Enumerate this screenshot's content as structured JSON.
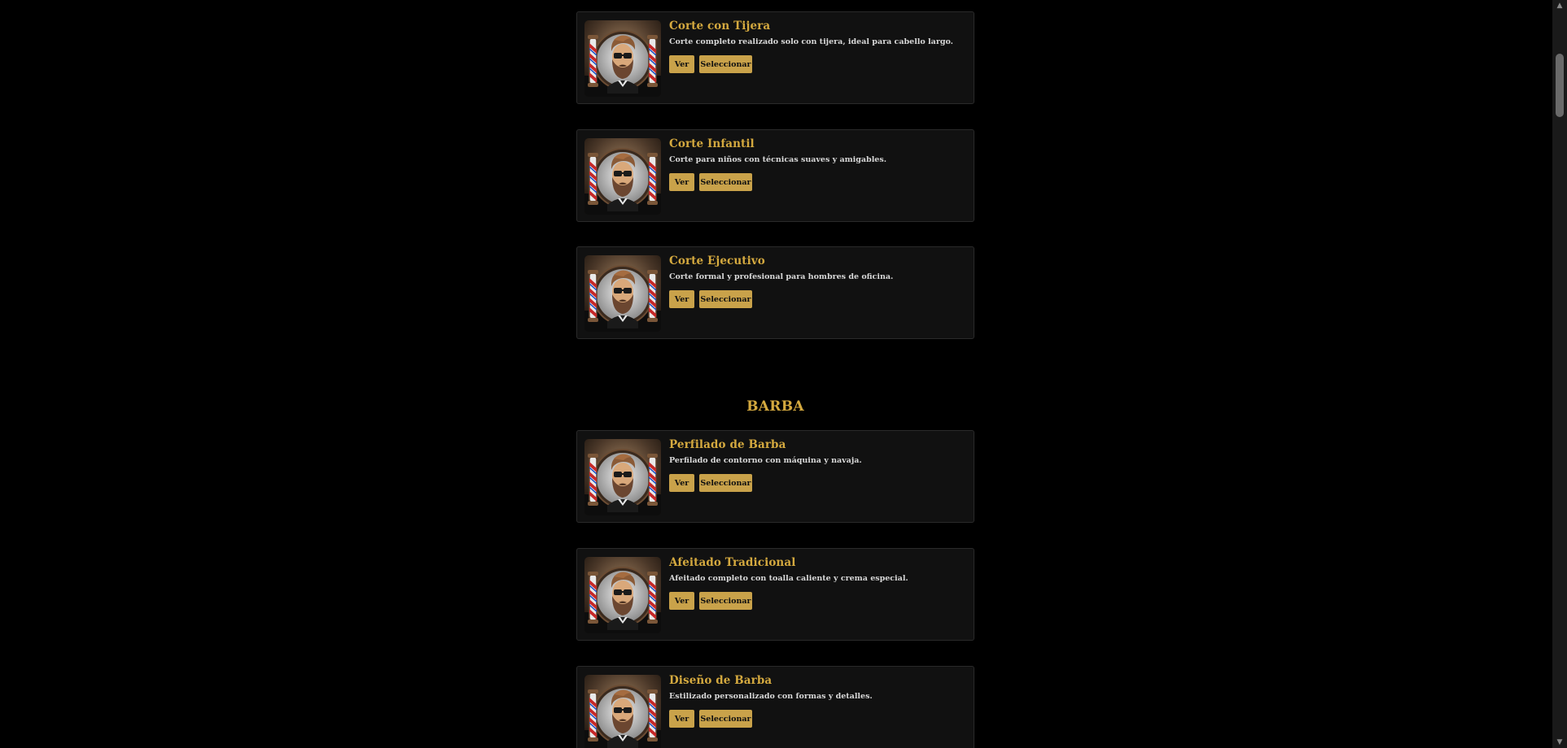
{
  "sections": [
    {
      "heading": "",
      "items": [
        {
          "title": "Corte con Tijera",
          "description": "Corte completo realizado solo con tijera, ideal para cabello largo.",
          "view_label": "Ver",
          "select_label": "Seleccionar"
        },
        {
          "title": "Corte Infantil",
          "description": "Corte para niños con técnicas suaves y amigables.",
          "view_label": "Ver",
          "select_label": "Seleccionar"
        },
        {
          "title": "Corte Ejecutivo",
          "description": "Corte formal y profesional para hombres de oficina.",
          "view_label": "Ver",
          "select_label": "Seleccionar"
        }
      ]
    },
    {
      "heading": "BARBA",
      "items": [
        {
          "title": "Perfilado de Barba",
          "description": "Perfilado de contorno con máquina y navaja.",
          "view_label": "Ver",
          "select_label": "Seleccionar"
        },
        {
          "title": "Afeitado Tradicional",
          "description": "Afeitado completo con toalla caliente y crema especial.",
          "view_label": "Ver",
          "select_label": "Seleccionar"
        },
        {
          "title": "Diseño de Barba",
          "description": "Estilizado personalizado con formas y detalles.",
          "view_label": "Ver",
          "select_label": "Seleccionar"
        }
      ]
    }
  ],
  "theme": {
    "accent": "#d4a93f",
    "button": "#c9a24a",
    "card_bg": "#111111",
    "page_bg": "#000000"
  },
  "scrollbar": {
    "up_icon": "triangle-up-icon",
    "down_icon": "triangle-down-icon"
  }
}
